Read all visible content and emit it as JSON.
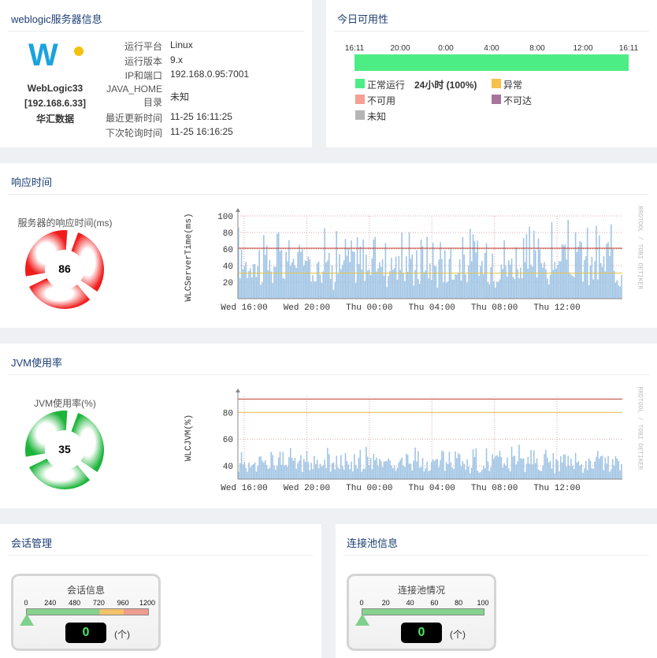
{
  "server_info": {
    "title": "weblogic服务器信息",
    "logo_letter": "W",
    "name": "WebLogic33",
    "ip_bracket": "[192.168.6.33]",
    "org": "华汇数据",
    "rows": [
      {
        "key": "运行平台",
        "value": "Linux"
      },
      {
        "key": "运行版本",
        "value": "9.x"
      },
      {
        "key": "IP和端口",
        "value": "192.168.0.95:7001"
      },
      {
        "key": "JAVA_HOME\n目录",
        "key1": "JAVA_HOME",
        "key2": "目录",
        "value": "未知"
      },
      {
        "key": "最近更新时间",
        "value": "11-25 16:11:25"
      },
      {
        "key": "下次轮询时间",
        "value": "11-25 16:16:25"
      }
    ]
  },
  "availability": {
    "title": "今日可用性",
    "ticks": [
      "16:11",
      "20:00",
      "0:00",
      "4:00",
      "8:00",
      "12:00",
      "16:11"
    ],
    "legend": [
      {
        "label": "正常运行",
        "extra": "24小时 (100%)",
        "color": "#4ded85"
      },
      {
        "label": "异常",
        "color": "#f7c04a"
      },
      {
        "label": "不可用",
        "color": "#f4a092"
      },
      {
        "label": "不可达",
        "color": "#a6759c"
      },
      {
        "label": "未知",
        "color": "#b5b5b5"
      }
    ],
    "uptime_fraction": 1.0
  },
  "response": {
    "title": "响应时间",
    "gauge_label": "服务器的响应时间(ms)",
    "gauge_value": "86",
    "gauge_color": "#f01c1c",
    "chart_data": {
      "type": "bar",
      "ylabel": "WLCServerTime(ms)",
      "yticks": [
        20,
        40,
        60,
        80,
        100
      ],
      "ylim": [
        0,
        100
      ],
      "xticks": [
        "Wed 16:00",
        "Wed 20:00",
        "Thu 00:00",
        "Thu 04:00",
        "Thu 08:00",
        "Thu 12:00"
      ],
      "threshold_red": 61,
      "threshold_yellow": 31,
      "side_text": "RRDTOOL / TOBI OETIKER",
      "bar_color": "#a0c4e4",
      "series_range": [
        10,
        100
      ],
      "bar_count": 260
    }
  },
  "jvm": {
    "title": "JVM使用率",
    "gauge_label": "JVM使用率(%)",
    "gauge_value": "35",
    "gauge_color": "#1cb43a",
    "chart_data": {
      "type": "bar",
      "ylabel": "WLCJVM(%)",
      "yticks": [
        40,
        60,
        80
      ],
      "ylim": [
        30,
        92
      ],
      "xticks": [
        "Wed 16:00",
        "Wed 20:00",
        "Thu 00:00",
        "Thu 04:00",
        "Thu 08:00",
        "Thu 12:00"
      ],
      "threshold_red": 90,
      "threshold_yellow": 80,
      "side_text": "RRDTOOL / TOBI OETIKER",
      "bar_color": "#a0c4e4",
      "series_range": [
        34,
        56
      ],
      "bar_count": 260
    }
  },
  "session": {
    "title": "会话管理",
    "meter_title": "会话信息",
    "ticks": [
      "0",
      "240",
      "480",
      "720",
      "960",
      "1200"
    ],
    "value": "0",
    "unit": "(个)"
  },
  "pool": {
    "title": "连接池信息",
    "meter_title": "连接池情况",
    "ticks": [
      "0",
      "20",
      "40",
      "60",
      "80",
      "100"
    ],
    "value": "0",
    "unit": "(个)"
  }
}
